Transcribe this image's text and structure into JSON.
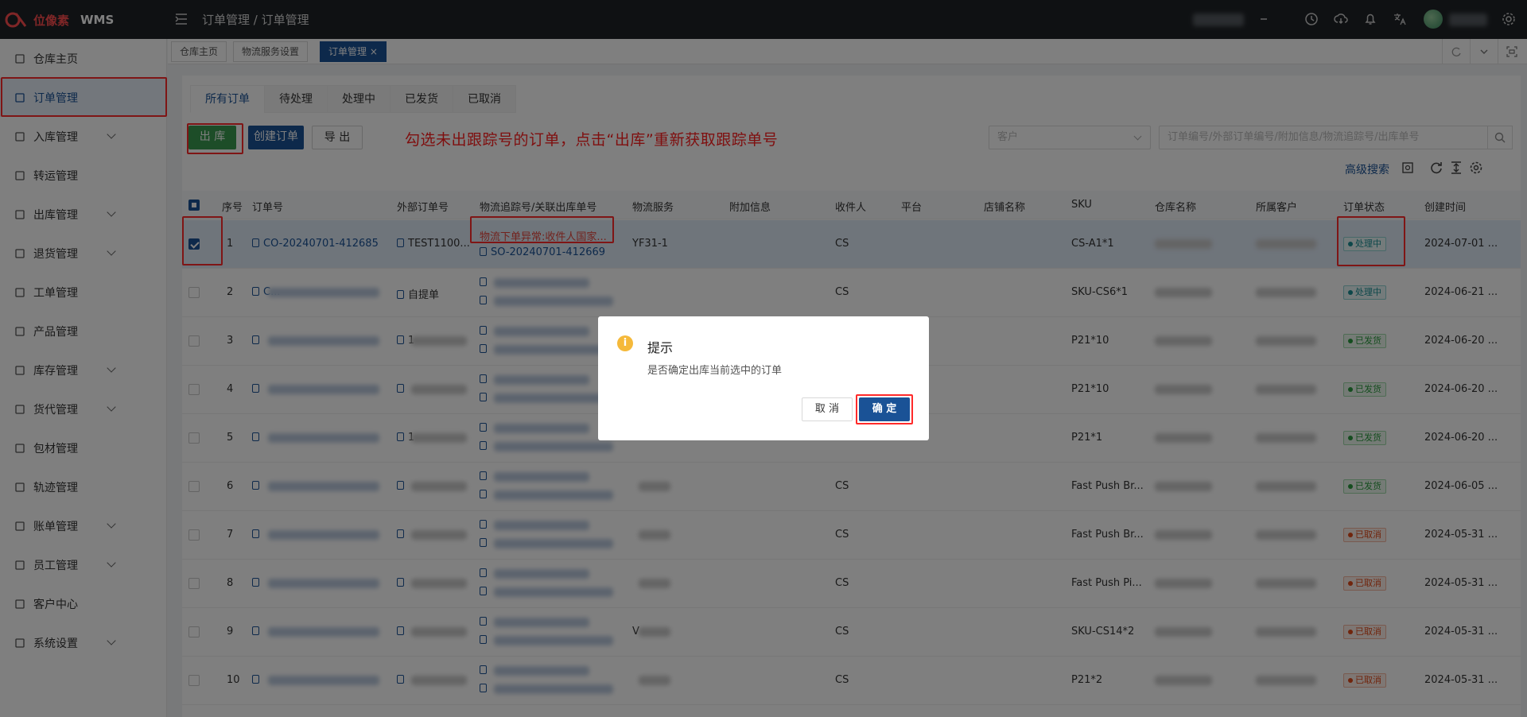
{
  "header": {
    "brand": "位像素",
    "product": "WMS",
    "breadcrumb": "订单管理 / 订单管理"
  },
  "sidebar": {
    "items": [
      {
        "label": "仓库主页",
        "icon": "dashboard-icon"
      },
      {
        "label": "订单管理",
        "icon": "order-icon",
        "active": true
      },
      {
        "label": "入库管理",
        "icon": "inbound-icon",
        "expandable": true
      },
      {
        "label": "转运管理",
        "icon": "transfer-icon"
      },
      {
        "label": "出库管理",
        "icon": "outbound-icon",
        "expandable": true
      },
      {
        "label": "退货管理",
        "icon": "return-icon",
        "expandable": true
      },
      {
        "label": "工单管理",
        "icon": "ticket-icon"
      },
      {
        "label": "产品管理",
        "icon": "product-icon"
      },
      {
        "label": "库存管理",
        "icon": "inventory-icon",
        "expandable": true
      },
      {
        "label": "货代管理",
        "icon": "forwarder-icon",
        "expandable": true
      },
      {
        "label": "包材管理",
        "icon": "packaging-icon"
      },
      {
        "label": "轨迹管理",
        "icon": "track-icon"
      },
      {
        "label": "账单管理",
        "icon": "bill-icon",
        "expandable": true
      },
      {
        "label": "员工管理",
        "icon": "staff-icon",
        "expandable": true
      },
      {
        "label": "客户中心",
        "icon": "customer-icon"
      },
      {
        "label": "系统设置",
        "icon": "settings-icon",
        "expandable": true
      }
    ]
  },
  "tabs": {
    "home": "仓库主页",
    "logistics": "物流服务设置",
    "orders": "订单管理",
    "close_glyph": "×"
  },
  "status_tabs": [
    "所有订单",
    "待处理",
    "处理中",
    "已发货",
    "已取消"
  ],
  "toolbar": {
    "outbound": "出 库",
    "create": "创建订单",
    "export": "导 出",
    "instruction": "勾选未出跟踪号的订单，点击“出库”重新获取跟踪单号",
    "customer_placeholder": "客户",
    "search_placeholder": "订单编号/外部订单编号/附加信息/物流追踪号/出库单号",
    "advanced": "高级搜索"
  },
  "table": {
    "headers": [
      "序号",
      "订单号",
      "外部订单号",
      "物流追踪号/关联出库单号",
      "物流服务",
      "附加信息",
      "收件人",
      "平台",
      "店铺名称",
      "SKU",
      "仓库名称",
      "所属客户",
      "订单状态",
      "创建时间"
    ],
    "rows": [
      {
        "no": "1",
        "order": "CO-20240701-412685",
        "ext": "TEST1100...",
        "track1": "物流下单异常:收件人国家...",
        "track2": "SO-20240701-412669",
        "service": "YF31-1",
        "recipient": "CS",
        "sku": "CS-A1*1",
        "status": "处理中",
        "status_kind": "proc",
        "created": "2024-07-01 ...",
        "checked": true,
        "error": true
      },
      {
        "no": "2",
        "order": "C...",
        "ext": "自提单",
        "track1": "",
        "track2": "",
        "service": "",
        "recipient": "CS",
        "sku": "SKU-CS6*1",
        "status": "处理中",
        "status_kind": "proc",
        "created": "2024-06-21 ..."
      },
      {
        "no": "3",
        "order": "",
        "ext": "1",
        "track1": "",
        "track2": "",
        "service": "",
        "recipient": "",
        "sku": "P21*10",
        "status": "已发货",
        "status_kind": "ship",
        "created": "2024-06-20 ..."
      },
      {
        "no": "4",
        "order": "",
        "ext": "",
        "track1": "",
        "track2": "",
        "service": "",
        "recipient": "",
        "sku": "P21*10",
        "status": "已发货",
        "status_kind": "ship",
        "created": "2024-06-20 ..."
      },
      {
        "no": "5",
        "order": "",
        "ext": "1",
        "track1": "",
        "track2": "",
        "service": "",
        "recipient": "",
        "sku": "P21*1",
        "status": "已发货",
        "status_kind": "ship",
        "created": "2024-06-20 ..."
      },
      {
        "no": "6",
        "order": "",
        "ext": "",
        "track1": "",
        "track2": "",
        "service": "",
        "recipient": "CS",
        "sku": "Fast Push Br...",
        "status": "已发货",
        "status_kind": "ship",
        "created": "2024-06-05 ..."
      },
      {
        "no": "7",
        "order": "",
        "ext": "",
        "track1": "",
        "track2": "",
        "service": "",
        "recipient": "CS",
        "sku": "Fast Push Br...",
        "status": "已取消",
        "status_kind": "can",
        "created": "2024-05-31 ..."
      },
      {
        "no": "8",
        "order": "",
        "ext": "",
        "track1": "",
        "track2": "",
        "service": "",
        "recipient": "CS",
        "sku": "Fast Push Pi...",
        "status": "已取消",
        "status_kind": "can",
        "created": "2024-05-31 ..."
      },
      {
        "no": "9",
        "order": "",
        "ext": "",
        "track1": "",
        "track2": "",
        "service": "V",
        "recipient": "CS",
        "sku": "SKU-CS14*2",
        "status": "已取消",
        "status_kind": "can",
        "created": "2024-05-31 ..."
      },
      {
        "no": "10",
        "order": "",
        "ext": "",
        "track1": "",
        "track2": "",
        "service": "",
        "recipient": "CS",
        "sku": "P21*2",
        "status": "已取消",
        "status_kind": "can",
        "created": "2024-05-31 ..."
      }
    ]
  },
  "modal": {
    "icon_glyph": "i",
    "title": "提示",
    "message": "是否确定出库当前选中的订单",
    "cancel": "取 消",
    "ok": "确 定"
  },
  "colors": {
    "brand_blue": "#1a5296",
    "outbound_green": "#3a9a50",
    "highlight_red": "#ff2a2a",
    "header_dark": "#1f2327"
  }
}
